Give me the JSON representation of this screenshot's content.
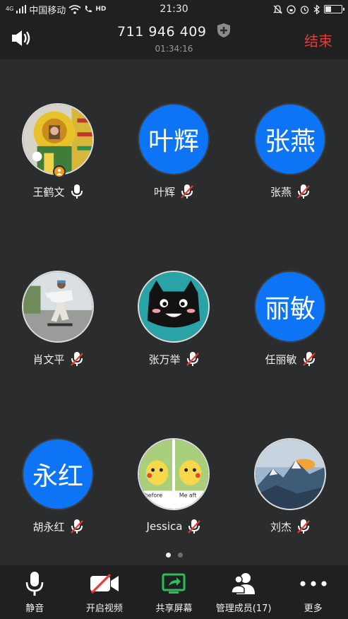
{
  "status_bar": {
    "carrier": "中国移动",
    "time": "21:30",
    "network": "4G",
    "hd": "HD"
  },
  "header": {
    "meeting_id": "711 946 409",
    "duration": "01:34:16",
    "end_label": "结束"
  },
  "participants": [
    {
      "name": "王鹤文",
      "avatar_type": "image",
      "image": "lion-costume-photo",
      "host": true,
      "muted": false
    },
    {
      "name": "叶辉",
      "avatar_type": "text",
      "avatar_text": "叶辉",
      "muted": true
    },
    {
      "name": "张燕",
      "avatar_type": "text",
      "avatar_text": "张燕",
      "muted": true
    },
    {
      "name": "肖文平",
      "avatar_type": "image",
      "image": "skateboarder-photo",
      "muted": true
    },
    {
      "name": "张万举",
      "avatar_type": "image",
      "image": "black-cat-cartoon",
      "muted": true
    },
    {
      "name": "任丽敏",
      "avatar_type": "text",
      "avatar_text": "丽敏",
      "muted": true
    },
    {
      "name": "胡永红",
      "avatar_type": "text",
      "avatar_text": "永红",
      "muted": true
    },
    {
      "name": "Jessica",
      "avatar_type": "image",
      "image": "pikachu-before-after",
      "muted": true
    },
    {
      "name": "刘杰",
      "avatar_type": "image",
      "image": "mountain-sunset-photo",
      "muted": true
    }
  ],
  "jessica_avatar_text": {
    "left": "before",
    "right": "Me aft"
  },
  "pager": {
    "pages": 2,
    "current": 1
  },
  "toolbar": {
    "mute_label": "静音",
    "video_label": "开启视频",
    "share_label": "共享屏幕",
    "members_label": "管理成员(17)",
    "more_label": "更多"
  },
  "colors": {
    "accent_blue": "#0c74f5",
    "end_red": "#e63b32",
    "share_green": "#2dbd5a",
    "host_orange": "#f29a1f"
  }
}
